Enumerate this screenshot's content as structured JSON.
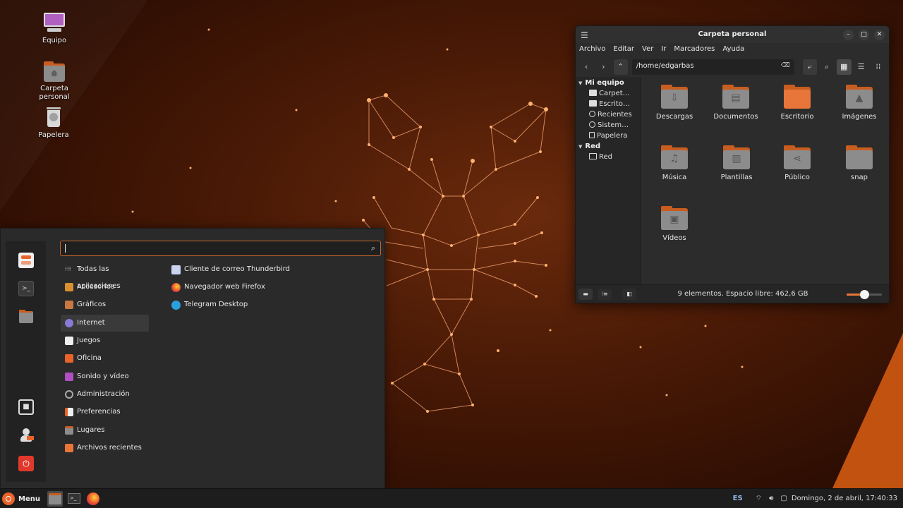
{
  "desktop": {
    "icons": [
      {
        "label": "Equipo"
      },
      {
        "label": "Carpeta personal"
      },
      {
        "label": "Papelera"
      }
    ]
  },
  "file_manager": {
    "title": "Carpeta personal",
    "menu": [
      "Archivo",
      "Editar",
      "Ver",
      "Ir",
      "Marcadores",
      "Ayuda"
    ],
    "path": "/home/edgarbas",
    "sidebar": {
      "sections": [
        {
          "title": "Mi equipo",
          "items": [
            "Carpet…",
            "Escrito…",
            "Recientes",
            "Sistem…",
            "Papelera"
          ]
        },
        {
          "title": "Red",
          "items": [
            "Red"
          ]
        }
      ]
    },
    "folders": [
      "Descargas",
      "Documentos",
      "Escritorio",
      "Imágenes",
      "Música",
      "Plantillas",
      "Público",
      "snap",
      "Vídeos"
    ],
    "status": "9 elementos. Espacio libre: 462,6 GB",
    "zoom_level": 0.5
  },
  "start_menu": {
    "search_value": "",
    "categories": [
      "Todas las aplicaciones",
      "Accesorios",
      "Gráficos",
      "Internet",
      "Juegos",
      "Oficina",
      "Sonido y vídeo",
      "Administración",
      "Preferencias",
      "Lugares",
      "Archivos recientes"
    ],
    "selected_category": "Internet",
    "apps": [
      "Cliente de correo Thunderbird",
      "Navegador web Firefox",
      "Telegram Desktop"
    ]
  },
  "panel": {
    "menu_label": "Menu",
    "keyboard_layout": "ES",
    "clock": "Domingo,  2 de abril, 17:40:33"
  },
  "colors": {
    "accent": "#e8763a",
    "folder": "#c85d20",
    "wallpaper": "#4a1a06"
  }
}
